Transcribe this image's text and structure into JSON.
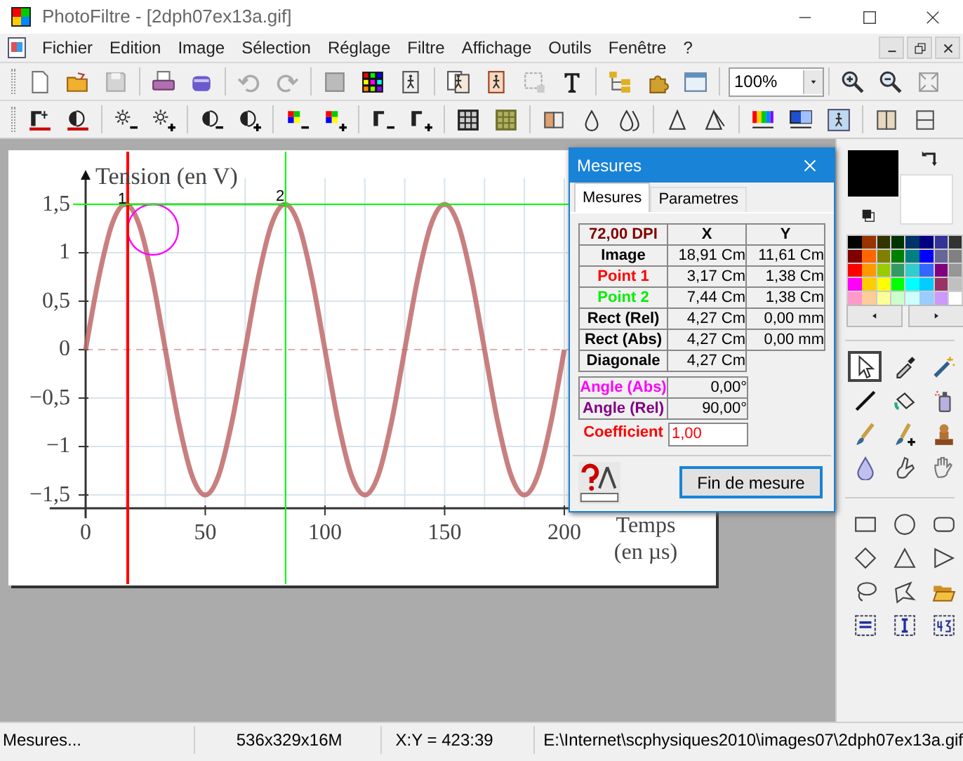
{
  "window": {
    "title": "PhotoFiltre - [2dph07ex13a.gif]"
  },
  "menu": [
    "Fichier",
    "Edition",
    "Image",
    "Sélection",
    "Réglage",
    "Filtre",
    "Affichage",
    "Outils",
    "Fenêtre",
    "?"
  ],
  "zoom_box": {
    "value": "100%"
  },
  "image": {
    "chart_data": {
      "type": "line",
      "ylabel": "Tension (en V)",
      "xlabel": "Temps (en µs)",
      "x": [
        0,
        5.56,
        11.11,
        16.67,
        22.22,
        27.78,
        33.33,
        38.89,
        44.44,
        50,
        55.56,
        61.11,
        66.67,
        72.22,
        77.78,
        83.33,
        88.89,
        94.44,
        100,
        105.56,
        111.11,
        116.67,
        122.22,
        127.78,
        133.33,
        138.89,
        144.44,
        150,
        155.56,
        161.11,
        166.67,
        172.22,
        177.78,
        183.33,
        188.89,
        194.44,
        200
      ],
      "series": [
        {
          "color": "#c06868",
          "values": [
            0,
            0.75,
            1.3,
            1.5,
            1.3,
            0.75,
            0,
            -0.75,
            -1.3,
            -1.5,
            -1.3,
            -0.75,
            0,
            0.75,
            1.3,
            1.5,
            1.3,
            0.75,
            0,
            -0.75,
            -1.3,
            -1.5,
            -1.3,
            -0.75,
            0,
            0.75,
            1.3,
            1.5,
            1.3,
            0.75,
            0,
            -0.75,
            -1.3,
            -1.5,
            -1.3,
            -0.75,
            0
          ]
        }
      ],
      "xticks": [
        0,
        50,
        100,
        150,
        200
      ],
      "xlim": [
        -15,
        263
      ],
      "ylim": [
        -1.74,
        1.77
      ],
      "grid": true,
      "ref_lines": [
        {
          "axis": "y",
          "value": 0
        }
      ],
      "yticks": [
        {
          "value": 1.5,
          "label": "1,5"
        },
        {
          "value": 1,
          "label": "1"
        },
        {
          "value": 0.5,
          "label": "0,5"
        },
        {
          "value": 0,
          "label": "0"
        },
        {
          "value": -0.5,
          "label": "−0,5"
        },
        {
          "value": -1,
          "label": "−1"
        },
        {
          "value": -1.5,
          "label": "−1,5"
        }
      ]
    },
    "measure_marks": [
      {
        "label": "1",
        "color": "#ff0000"
      },
      {
        "label": "2",
        "color": "#00ff00"
      }
    ]
  },
  "measure_dialog": {
    "title": "Mesures",
    "tabs": [
      {
        "label": "Mesures",
        "selected": true
      },
      {
        "label": "Parametres",
        "selected": false
      }
    ],
    "dpi": {
      "label": "72,00 DPI",
      "color": "#800000"
    },
    "columns": [
      "X",
      "Y"
    ],
    "rows": [
      {
        "label": "Image",
        "color": "#000000",
        "x": "18,91 Cm",
        "y": "11,61 Cm"
      },
      {
        "label": "Point 1",
        "color": "#ff0000",
        "x": "3,17 Cm",
        "y": "1,38 Cm"
      },
      {
        "label": "Point 2",
        "color": "#00ee00",
        "x": "7,44 Cm",
        "y": "1,38 Cm"
      },
      {
        "label": "Rect (Rel)",
        "color": "#000000",
        "x": "4,27 Cm",
        "y": "0,00 mm"
      },
      {
        "label": "Rect (Abs)",
        "color": "#000000",
        "x": "4,27 Cm",
        "y": "0,00 mm"
      },
      {
        "label": "Diagonale",
        "color": "#000000",
        "x": "4,27 Cm"
      }
    ],
    "angles": [
      {
        "label": "Angle (Abs)",
        "color": "#ff00ff",
        "value": "0,00°"
      },
      {
        "label": "Angle (Rel)",
        "color": "#800080",
        "value": "90,00°"
      }
    ],
    "coefficient": {
      "label": "Coefficient",
      "color": "#ff0000",
      "value": "1,00"
    },
    "button": "Fin de mesure"
  },
  "palette": {
    "swatches": [
      {
        "color": "#000000"
      },
      {
        "color": "#993300"
      },
      {
        "color": "#333300"
      },
      {
        "color": "#003300"
      },
      {
        "color": "#003366"
      },
      {
        "color": "#000080"
      },
      {
        "color": "#333399"
      },
      {
        "color": "#333333"
      },
      {
        "color": "#800000"
      },
      {
        "color": "#ff6600"
      },
      {
        "color": "#808000"
      },
      {
        "color": "#008000"
      },
      {
        "color": "#008080"
      },
      {
        "color": "#0000ff"
      },
      {
        "color": "#666699"
      },
      {
        "color": "#808080"
      },
      {
        "color": "#ff0000"
      },
      {
        "color": "#ff9900"
      },
      {
        "color": "#99cc00"
      },
      {
        "color": "#339966"
      },
      {
        "color": "#33cccc"
      },
      {
        "color": "#3366ff"
      },
      {
        "color": "#800080"
      },
      {
        "color": "#969696"
      },
      {
        "color": "#ff00ff"
      },
      {
        "color": "#ffcc00"
      },
      {
        "color": "#ffff00"
      },
      {
        "color": "#00ff00"
      },
      {
        "color": "#00ffff"
      },
      {
        "color": "#00ccff"
      },
      {
        "color": "#993366"
      },
      {
        "color": "#c0c0c0"
      },
      {
        "color": "#ff99cc"
      },
      {
        "color": "#ffcc99"
      },
      {
        "color": "#ffff99"
      },
      {
        "color": "#ccffcc"
      },
      {
        "color": "#ccffff"
      },
      {
        "color": "#99ccff"
      },
      {
        "color": "#cc99ff"
      },
      {
        "color": "#ffffff"
      }
    ]
  },
  "tools": [
    {
      "kind": "pointer",
      "selected": true
    },
    {
      "kind": "eyedropper",
      "selected": false
    },
    {
      "kind": "wand",
      "selected": false
    },
    {
      "kind": "line",
      "selected": false
    },
    {
      "kind": "bucket",
      "selected": false
    },
    {
      "kind": "spray",
      "selected": false
    },
    {
      "kind": "brush",
      "selected": false
    },
    {
      "kind": "brushplus",
      "selected": false
    },
    {
      "kind": "stamp",
      "selected": false
    },
    {
      "kind": "drop",
      "selected": false
    },
    {
      "kind": "finger",
      "selected": false
    },
    {
      "kind": "hand",
      "selected": false
    }
  ],
  "shape_tools": [
    {
      "kind": "rect",
      "selected": false
    },
    {
      "kind": "ellipse",
      "selected": false
    },
    {
      "kind": "roundrect",
      "selected": false
    },
    {
      "kind": "diamond",
      "selected": false
    },
    {
      "kind": "triangle",
      "selected": false
    },
    {
      "kind": "triright",
      "selected": false
    },
    {
      "kind": "lasso",
      "selected": false
    },
    {
      "kind": "polylasso",
      "selected": false
    },
    {
      "kind": "folder",
      "selected": false
    },
    {
      "kind": "hfit",
      "selected": false
    },
    {
      "kind": "vfit",
      "selected": false
    },
    {
      "kind": "ratio",
      "selected": false
    }
  ],
  "status_bar": [
    "Mesures...",
    "536x329x16M",
    "X:Y = 423:39",
    "E:\\Internet\\scphysiques2010\\images07\\2dph07ex13a.gif"
  ]
}
